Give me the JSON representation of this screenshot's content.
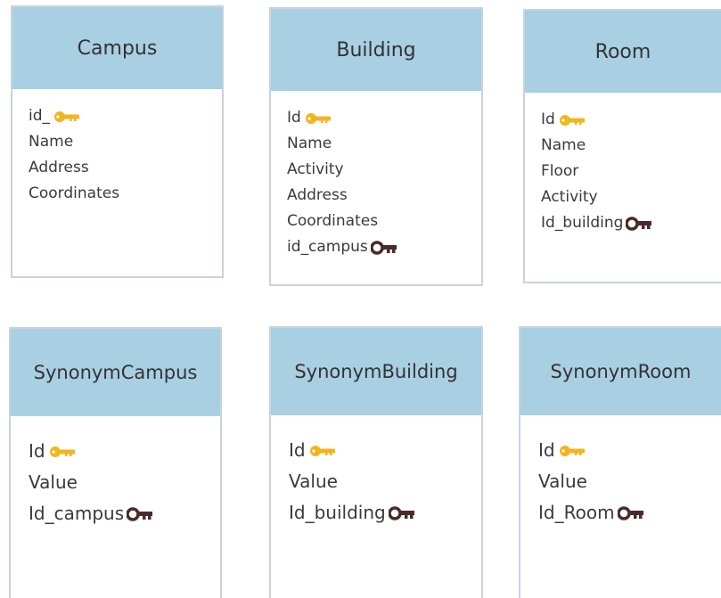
{
  "diagram": {
    "entities": [
      {
        "id": "campus",
        "title": "Campus",
        "fields": [
          {
            "label": "id_",
            "key": "primary"
          },
          {
            "label": "Name",
            "key": "none"
          },
          {
            "label": "Address",
            "key": "none"
          },
          {
            "label": "Coordinates",
            "key": "none"
          }
        ]
      },
      {
        "id": "building",
        "title": "Building",
        "fields": [
          {
            "label": "Id",
            "key": "primary"
          },
          {
            "label": "Name",
            "key": "none"
          },
          {
            "label": "Activity",
            "key": "none"
          },
          {
            "label": "Address",
            "key": "none"
          },
          {
            "label": "Coordinates",
            "key": "none"
          },
          {
            "label": "id_campus",
            "key": "foreign"
          }
        ]
      },
      {
        "id": "room",
        "title": "Room",
        "fields": [
          {
            "label": "Id",
            "key": "primary"
          },
          {
            "label": "Name",
            "key": "none"
          },
          {
            "label": "Floor",
            "key": "none"
          },
          {
            "label": "Activity",
            "key": "none"
          },
          {
            "label": "Id_building",
            "key": "foreign"
          }
        ]
      },
      {
        "id": "synonym-campus",
        "title": "SynonymCampus",
        "fields": [
          {
            "label": "Id",
            "key": "primary"
          },
          {
            "label": "Value",
            "key": "none"
          },
          {
            "label": "Id_campus",
            "key": "foreign"
          }
        ]
      },
      {
        "id": "synonym-building",
        "title": "SynonymBuilding",
        "fields": [
          {
            "label": "Id",
            "key": "primary"
          },
          {
            "label": "Value",
            "key": "none"
          },
          {
            "label": "Id_building",
            "key": "foreign"
          }
        ]
      },
      {
        "id": "synonym-room",
        "title": "SynonymRoom",
        "fields": [
          {
            "label": "Id",
            "key": "primary"
          },
          {
            "label": "Value",
            "key": "none"
          },
          {
            "label": "Id_Room",
            "key": "foreign"
          }
        ]
      }
    ],
    "icons": {
      "primary": "primary-key-icon",
      "foreign": "foreign-key-icon"
    },
    "colors": {
      "header_fill": "#a9cfe3",
      "border": "#c8d3df",
      "primary_key": "#f2b51e",
      "foreign_key": "#4a2a2a",
      "text": "#3a3a3a"
    }
  }
}
